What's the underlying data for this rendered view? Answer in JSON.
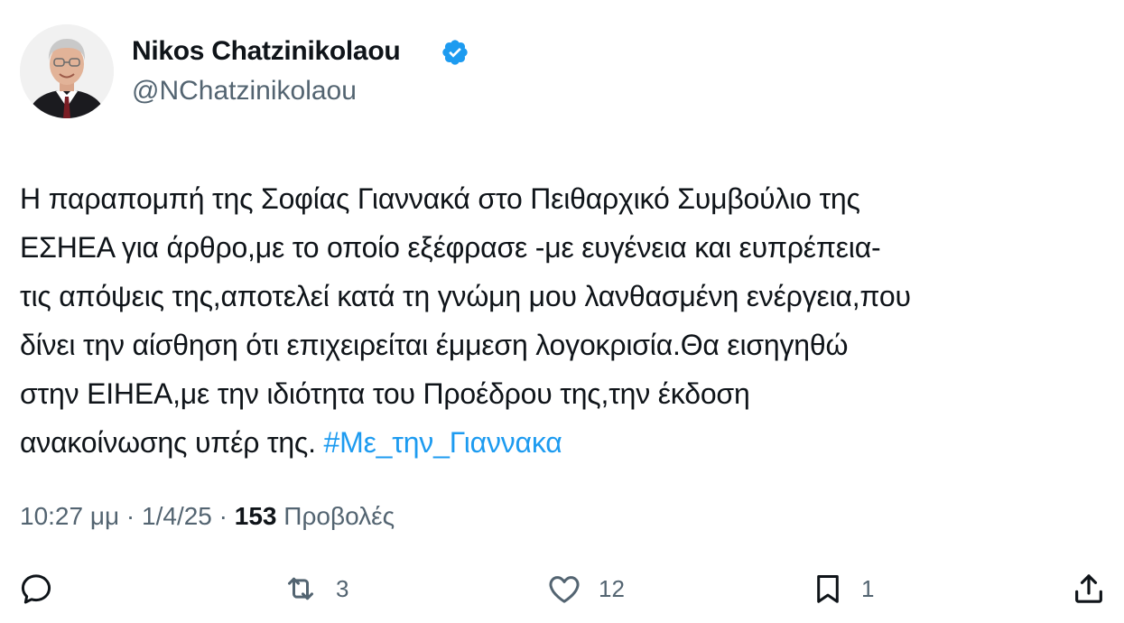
{
  "author": {
    "display_name": "Nikos Chatzinikolaou",
    "handle": "@NChatzinikolaou",
    "verified_icon": "verified-badge-icon",
    "verified_color": "#1d9bf0"
  },
  "tweet": {
    "lines": [
      "Η παραπομπή της Σοφίας Γιαννακά στο Πειθαρχικό Συμβούλιο της",
      "ΕΣΗΕΑ για άρθρο,με το οποίο εξέφρασε -με ευγένεια και ευπρέπεια-",
      "τις απόψεις της,αποτελεί κατά τη γνώμη μου λανθασμένη ενέργεια,που",
      "δίνει την αίσθηση ότι επιχειρείται έμμεση λογοκρισία.Θα εισηγηθώ",
      "στην ΕΙΗΕΑ,με την ιδιότητα του Προέδρου της,την έκδοση"
    ],
    "last_line_text": "ανακοίνωσης υπέρ της. ",
    "hashtag": "#Με_την_Γιαννακα",
    "hashtag_color": "#1d9bf0"
  },
  "meta": {
    "time": "10:27 μμ",
    "separator": "·",
    "date": "1/4/25",
    "views_count": "153",
    "views_label": "Προβολές"
  },
  "actions": {
    "reply": {
      "icon": "reply-icon",
      "count": ""
    },
    "retweet": {
      "icon": "retweet-icon",
      "count": "3"
    },
    "like": {
      "icon": "heart-icon",
      "count": "12"
    },
    "bookmark": {
      "icon": "bookmark-icon",
      "count": "1"
    },
    "share": {
      "icon": "share-icon",
      "count": ""
    }
  },
  "colors": {
    "text": "#0f1419",
    "secondary": "#536471",
    "accent": "#1d9bf0"
  }
}
